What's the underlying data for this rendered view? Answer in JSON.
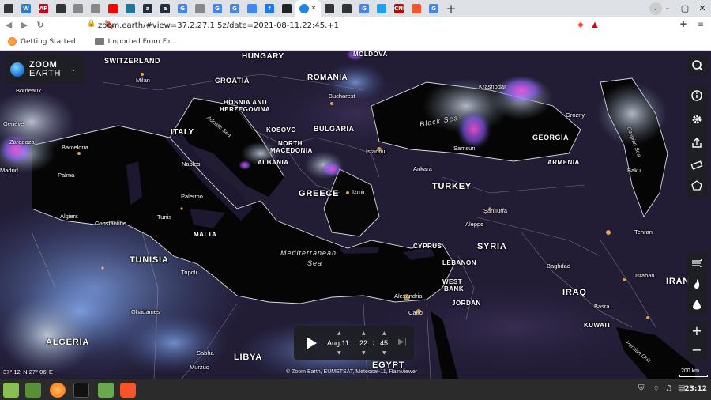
{
  "browser": {
    "tabs": [
      {
        "icon": "github-icon",
        "color": "#333333",
        "text": ""
      },
      {
        "icon": "word-icon",
        "color": "#2b7cd3",
        "text": "W"
      },
      {
        "icon": "ap-icon",
        "color": "#d0021b",
        "text": "AP"
      },
      {
        "icon": "github-icon",
        "color": "#333333",
        "text": ""
      },
      {
        "icon": "edit-icon",
        "color": "#888888",
        "text": ""
      },
      {
        "icon": "edit-icon",
        "color": "#888888",
        "text": ""
      },
      {
        "icon": "youtube-icon",
        "color": "#ff0000",
        "text": ""
      },
      {
        "icon": "wordpress-icon",
        "color": "#21759b",
        "text": ""
      },
      {
        "icon": "amazon-icon",
        "color": "#232f3e",
        "text": "a"
      },
      {
        "icon": "amazon-icon",
        "color": "#232f3e",
        "text": "a"
      },
      {
        "icon": "google-icon",
        "color": "#4285f4",
        "text": "G"
      },
      {
        "icon": "edit-icon",
        "color": "#888888",
        "text": ""
      },
      {
        "icon": "google-icon",
        "color": "#4285f4",
        "text": "G"
      },
      {
        "icon": "google-icon",
        "color": "#4285f4",
        "text": "G"
      },
      {
        "icon": "chrome-icon",
        "color": "#4285f4",
        "text": ""
      },
      {
        "icon": "facebook-icon",
        "color": "#1877f2",
        "text": "f"
      },
      {
        "icon": "npr-icon",
        "color": "#222222",
        "text": ""
      },
      {
        "icon": "github-icon",
        "color": "#333333",
        "text": ""
      },
      {
        "icon": "github-icon",
        "color": "#333333",
        "text": ""
      },
      {
        "icon": "google-icon",
        "color": "#4285f4",
        "text": "G"
      },
      {
        "icon": "twitter-icon",
        "color": "#1da1f2",
        "text": ""
      },
      {
        "icon": "cnn-icon",
        "color": "#cc0000",
        "text": "CNN"
      },
      {
        "icon": "brave-icon",
        "color": "#fb542b",
        "text": ""
      },
      {
        "icon": "google-icon",
        "color": "#4285f4",
        "text": "G"
      }
    ],
    "active_tab": {
      "icon": "zoom-earth-icon",
      "color": "#1e88e5"
    },
    "address": "zoom.earth/#view=37.2,27.1,5z/date=2021-08-11,22:45,+1",
    "bookmarks": [
      {
        "label": "Getting Started",
        "icon": "firefox-icon"
      },
      {
        "label": "Imported From Fir...",
        "icon": "folder-icon"
      }
    ]
  },
  "map": {
    "logo": {
      "line1": "ZOOM",
      "line2": "EARTH"
    },
    "labels": {
      "countries": [
        {
          "text": "HUNGARY"
        },
        {
          "text": "SWITZERLAND"
        },
        {
          "text": "MOLDOVA"
        },
        {
          "text": "CROATIA"
        },
        {
          "text": "ROMANIA"
        },
        {
          "text": "BOSNIA AND"
        },
        {
          "text": "HERZEGOVINA"
        },
        {
          "text": "ITALY"
        },
        {
          "text": "KOSOVO"
        },
        {
          "text": "BULGARIA"
        },
        {
          "text": "NORTH"
        },
        {
          "text": "MACEDONIA"
        },
        {
          "text": "ALBANIA"
        },
        {
          "text": "GREECE"
        },
        {
          "text": "TURKEY"
        },
        {
          "text": "GEORGIA"
        },
        {
          "text": "ARMENIA"
        },
        {
          "text": "MALTA"
        },
        {
          "text": "TUNISIA"
        },
        {
          "text": "CYPRUS"
        },
        {
          "text": "LEBANON"
        },
        {
          "text": "SYRIA"
        },
        {
          "text": "WEST"
        },
        {
          "text": "BANK"
        },
        {
          "text": "JORDAN"
        },
        {
          "text": "IRAQ"
        },
        {
          "text": "IRAN"
        },
        {
          "text": "KUWAIT"
        },
        {
          "text": "ALGERIA"
        },
        {
          "text": "LIBYA"
        },
        {
          "text": "EGYPT"
        }
      ],
      "cities": [
        {
          "text": "Bordeaux"
        },
        {
          "text": "Milan"
        },
        {
          "text": "Genève"
        },
        {
          "text": "Zaragoza"
        },
        {
          "text": "Madrid"
        },
        {
          "text": "Barcelona"
        },
        {
          "text": "Palma"
        },
        {
          "text": "Naples"
        },
        {
          "text": "Palermo"
        },
        {
          "text": "Tunis"
        },
        {
          "text": "Algiers"
        },
        {
          "text": "Constantine"
        },
        {
          "text": "Tripoli"
        },
        {
          "text": "Ghadames"
        },
        {
          "text": "Sabha"
        },
        {
          "text": "Murzuq"
        },
        {
          "text": "Bucharest"
        },
        {
          "text": "Istanbul"
        },
        {
          "text": "Ankara"
        },
        {
          "text": "Izmir"
        },
        {
          "text": "Samsun"
        },
        {
          "text": "Krasnodar"
        },
        {
          "text": "Grozny"
        },
        {
          "text": "Baku"
        },
        {
          "text": "Şanlıurfa"
        },
        {
          "text": "Aleppo"
        },
        {
          "text": "Alexandria"
        },
        {
          "text": "Cairo"
        },
        {
          "text": "Baghdad"
        },
        {
          "text": "Tehran"
        },
        {
          "text": "Isfahan"
        },
        {
          "text": "Basra"
        }
      ],
      "seas": [
        {
          "text": "Black Sea"
        },
        {
          "text": "Mediterranean"
        },
        {
          "text": "Sea"
        },
        {
          "text": "Adriatic Sea"
        },
        {
          "text": "Caspian Sea"
        },
        {
          "text": "Persian Gulf"
        }
      ]
    },
    "controls": {
      "search": "search-icon",
      "info": "info-icon",
      "settings": "gear-icon",
      "share": "share-icon",
      "measure": "ruler-icon",
      "draw": "pentagon-icon",
      "wind": "wind-icon",
      "fire": "fire-icon",
      "rain": "drop-icon",
      "zoom_in": "+",
      "zoom_out": "−"
    },
    "time": {
      "date": "Aug 11",
      "hour": "22",
      "minute": "45"
    },
    "coords": "37° 12′ N   27° 06′ E",
    "credits": "© Zoom Earth, EUMETSAT, Meteosat-11, RainViewer",
    "scale": "200 km"
  },
  "taskbar": {
    "apps": [
      "mint-menu-icon",
      "terminal-icon",
      "firefox-icon",
      "terminal-icon",
      "files-icon",
      "brave-icon"
    ],
    "clock": "23:12"
  }
}
